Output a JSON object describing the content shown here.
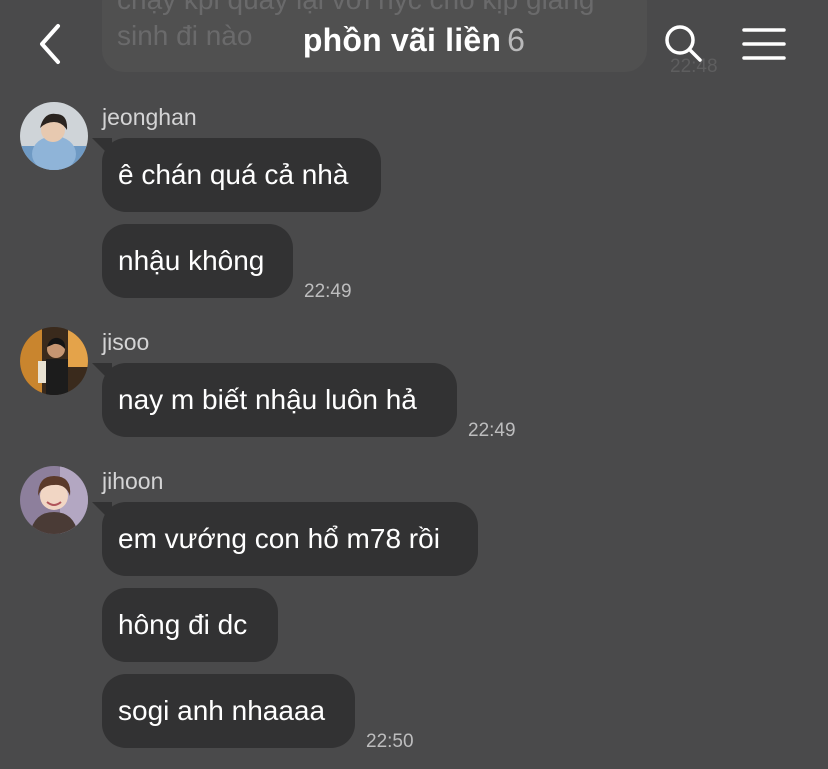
{
  "previous_message": {
    "text": "chạy kpi quay lại với nyc cho kịp giáng sinh đi nào",
    "time": "22:48"
  },
  "header": {
    "title": "phồn vãi liền",
    "member_count": "6"
  },
  "groups": [
    {
      "sender": "jeonghan",
      "messages": [
        "ê chán quá cả nhà",
        "nhậu không"
      ],
      "time": "22:49"
    },
    {
      "sender": "jisoo",
      "messages": [
        "nay m biết nhậu luôn hả"
      ],
      "time": "22:49"
    },
    {
      "sender": "jihoon",
      "messages": [
        "em vướng con hổ m78 rồi",
        "hông đi dc",
        "sogi anh nhaaaa"
      ],
      "time": "22:50"
    }
  ],
  "icons": [
    "back-arrow-icon",
    "search-icon",
    "menu-icon"
  ],
  "colors": {
    "background": "#4a4a4b",
    "bubble": "#323233",
    "text": "#ffffff",
    "muted": "#bdbdbe"
  }
}
